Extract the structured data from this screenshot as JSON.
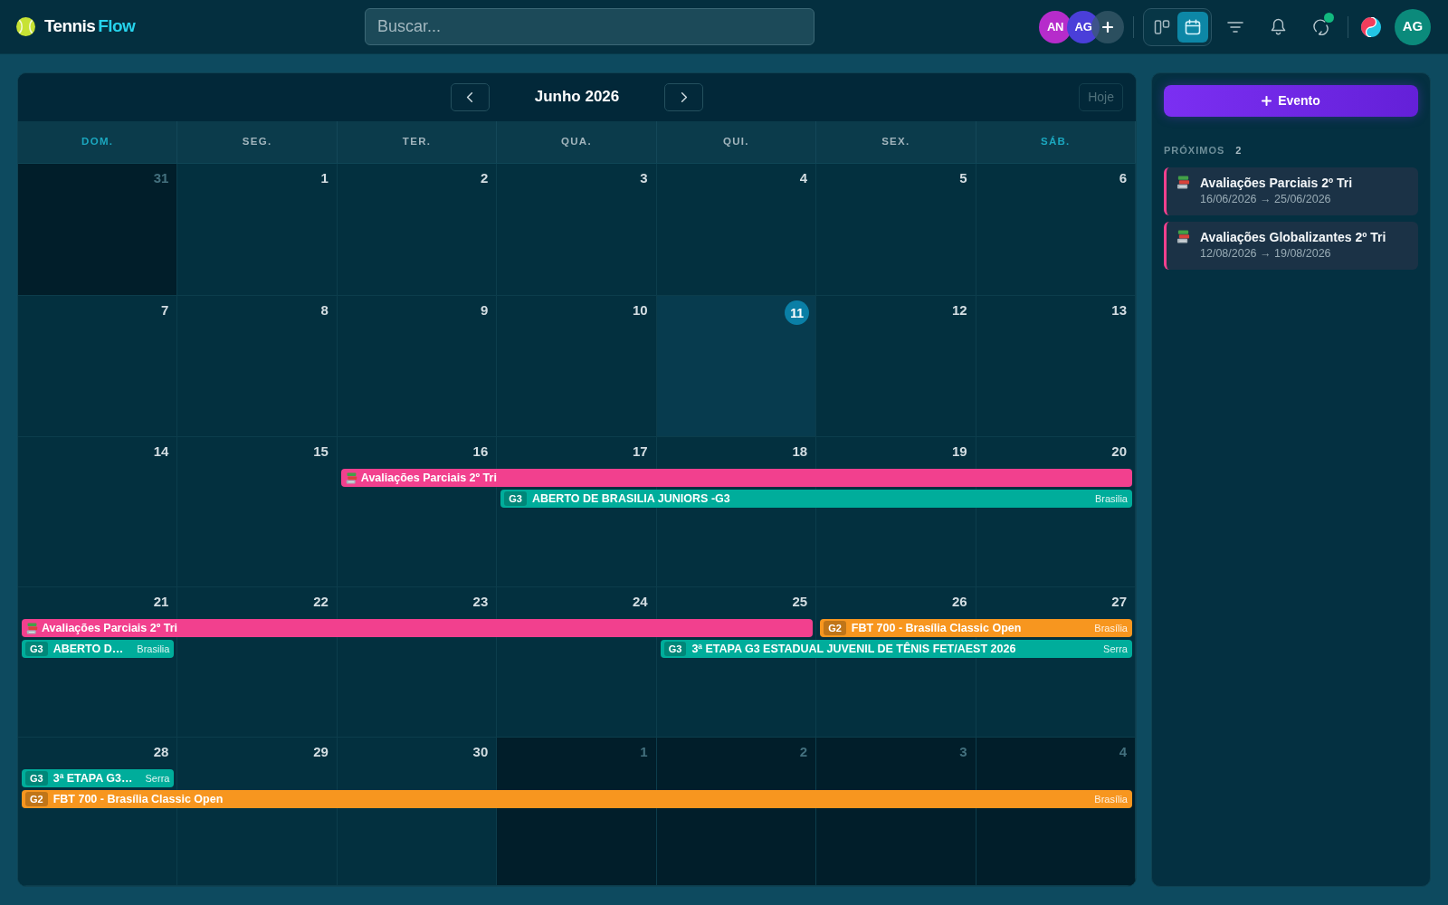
{
  "topbar": {
    "logo": {
      "text": "Tennis",
      "accent": "Flow"
    },
    "search": {
      "placeholder": "Buscar..."
    },
    "collaborators": [
      {
        "initials": "AN",
        "color": "#b62ccb"
      },
      {
        "initials": "AG",
        "color": "#4a3fd9"
      }
    ],
    "views": [
      {
        "kind": "board",
        "selected": false
      },
      {
        "kind": "calendar",
        "selected": true
      }
    ],
    "sync": {
      "alert": true
    },
    "user": {
      "initials": "AG"
    }
  },
  "calendar": {
    "title": "Junho 2026",
    "today_button": {
      "label": "Hoje",
      "disabled": true
    },
    "weekdays": [
      {
        "label": "DOM.",
        "weekend": true
      },
      {
        "label": "SEG.",
        "weekend": false
      },
      {
        "label": "TER.",
        "weekend": false
      },
      {
        "label": "QUA.",
        "weekend": false
      },
      {
        "label": "QUI.",
        "weekend": false
      },
      {
        "label": "SEX.",
        "weekend": false
      },
      {
        "label": "SÁB.",
        "weekend": true
      }
    ],
    "weeks": [
      {
        "days": [
          {
            "number": "31",
            "outside": true,
            "today": false
          },
          {
            "number": "1",
            "outside": false,
            "today": false
          },
          {
            "number": "2",
            "outside": false,
            "today": false
          },
          {
            "number": "3",
            "outside": false,
            "today": false
          },
          {
            "number": "4",
            "outside": false,
            "today": false
          },
          {
            "number": "5",
            "outside": false,
            "today": false
          },
          {
            "number": "6",
            "outside": false,
            "today": false
          }
        ]
      },
      {
        "days": [
          {
            "number": "7",
            "outside": false,
            "today": false
          },
          {
            "number": "8",
            "outside": false,
            "today": false
          },
          {
            "number": "9",
            "outside": false,
            "today": false
          },
          {
            "number": "10",
            "outside": false,
            "today": false
          },
          {
            "number": "11",
            "outside": false,
            "today": true
          },
          {
            "number": "12",
            "outside": false,
            "today": false
          },
          {
            "number": "13",
            "outside": false,
            "today": false
          }
        ]
      },
      {
        "days": [
          {
            "number": "14",
            "outside": false,
            "today": false
          },
          {
            "number": "15",
            "outside": false,
            "today": false
          },
          {
            "number": "16",
            "outside": false,
            "today": false
          },
          {
            "number": "17",
            "outside": false,
            "today": false
          },
          {
            "number": "18",
            "outside": false,
            "today": false
          },
          {
            "number": "19",
            "outside": false,
            "today": false
          },
          {
            "number": "20",
            "outside": false,
            "today": false
          }
        ],
        "lanes": [
          [
            {
              "kind": "empty"
            },
            {
              "kind": "empty"
            },
            {
              "kind": "start",
              "event": {
                "kind": "academic",
                "title": "Avaliações Parciais 2º Tri",
                "color": "#f2408e"
              }
            },
            {
              "kind": "continued"
            },
            {
              "kind": "continued"
            },
            {
              "kind": "continued"
            },
            {
              "kind": "continued"
            }
          ],
          [
            {
              "kind": "empty"
            },
            {
              "kind": "empty"
            },
            {
              "kind": "empty"
            },
            {
              "kind": "start",
              "event": {
                "kind": "tournament",
                "tag": "G3",
                "title": "ABERTO DE BRASILIA JUNIORS -G3",
                "location": "Brasilia",
                "color": "#00ad9b"
              }
            },
            {
              "kind": "continued"
            },
            {
              "kind": "continued"
            },
            {
              "kind": "continued"
            }
          ]
        ]
      },
      {
        "days": [
          {
            "number": "21",
            "outside": false,
            "today": false
          },
          {
            "number": "22",
            "outside": false,
            "today": false
          },
          {
            "number": "23",
            "outside": false,
            "today": false
          },
          {
            "number": "24",
            "outside": false,
            "today": false
          },
          {
            "number": "25",
            "outside": false,
            "today": false
          },
          {
            "number": "26",
            "outside": false,
            "today": false
          },
          {
            "number": "27",
            "outside": false,
            "today": false
          }
        ],
        "lanes": [
          [
            {
              "kind": "start",
              "event": {
                "kind": "academic",
                "title": "Avaliações Parciais 2º Tri",
                "color": "#f2408e"
              }
            },
            {
              "kind": "continued"
            },
            {
              "kind": "continued"
            },
            {
              "kind": "continued"
            },
            {
              "kind": "continued"
            },
            {
              "kind": "start",
              "event": {
                "kind": "tournament",
                "tag": "G2",
                "title": "FBT 700 - Brasília Classic Open",
                "location": "Brasília",
                "color": "#f7961f"
              }
            },
            {
              "kind": "continued"
            }
          ],
          [
            {
              "kind": "start",
              "event": {
                "kind": "tournament",
                "tag": "G3",
                "title": "ABERTO D…",
                "location": "Brasilia",
                "color": "#00ad9b"
              }
            },
            {
              "kind": "empty"
            },
            {
              "kind": "empty"
            },
            {
              "kind": "empty"
            },
            {
              "kind": "start",
              "event": {
                "kind": "tournament",
                "tag": "G3",
                "title": "3ª ETAPA G3 ESTADUAL JUVENIL DE TÊNIS FET/AEST 2026",
                "location": "Serra",
                "color": "#00ad9b"
              }
            },
            {
              "kind": "continued"
            },
            {
              "kind": "continued"
            }
          ]
        ]
      },
      {
        "days": [
          {
            "number": "28",
            "outside": false,
            "today": false
          },
          {
            "number": "29",
            "outside": false,
            "today": false
          },
          {
            "number": "30",
            "outside": false,
            "today": false
          },
          {
            "number": "1",
            "outside": true,
            "today": false
          },
          {
            "number": "2",
            "outside": true,
            "today": false
          },
          {
            "number": "3",
            "outside": true,
            "today": false
          },
          {
            "number": "4",
            "outside": true,
            "today": false
          }
        ],
        "lanes": [
          [
            {
              "kind": "start",
              "event": {
                "kind": "tournament",
                "tag": "G3",
                "title": "3ª ETAPA G3…",
                "location": "Serra",
                "color": "#00ad9b"
              }
            },
            {
              "kind": "empty"
            },
            {
              "kind": "empty"
            },
            {
              "kind": "empty"
            },
            {
              "kind": "empty"
            },
            {
              "kind": "empty"
            },
            {
              "kind": "empty"
            }
          ],
          [
            {
              "kind": "start",
              "event": {
                "kind": "tournament",
                "tag": "G2",
                "title": "FBT 700 - Brasília Classic Open",
                "location": "Brasília",
                "color": "#f7961f"
              }
            },
            {
              "kind": "continued"
            },
            {
              "kind": "continued"
            },
            {
              "kind": "continued"
            },
            {
              "kind": "continued"
            },
            {
              "kind": "continued"
            },
            {
              "kind": "continued"
            }
          ]
        ]
      }
    ]
  },
  "sidebar": {
    "add_button": "Evento",
    "upcoming": {
      "label": "PRÓXIMOS",
      "count": "2",
      "items": [
        {
          "kind": "academic",
          "title": "Avaliações Parciais 2º Tri",
          "dates": "16/06/2026 → 25/06/2026",
          "color": "#f2408e"
        },
        {
          "kind": "academic",
          "title": "Avaliações Globalizantes 2º Tri",
          "dates": "12/08/2026 → 19/08/2026",
          "color": "#f2408e"
        }
      ]
    }
  }
}
